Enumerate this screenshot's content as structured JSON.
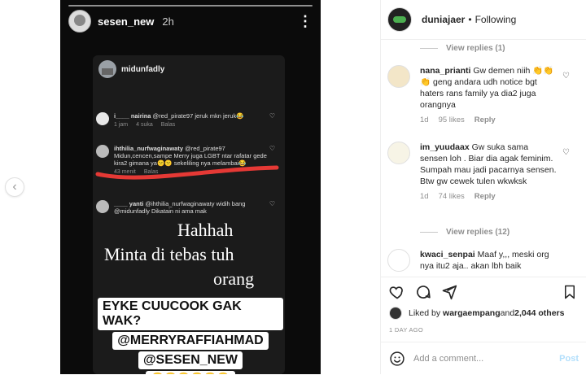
{
  "story": {
    "username": "sesen_new",
    "time": "2h",
    "more": "⋮",
    "card": {
      "username": "midunfadly",
      "comments": [
        {
          "user": "i____ nairina",
          "text": "@red_pirate97 jeruk mkn jeruk😂",
          "meta": [
            "1 jam",
            "4 suka",
            "Balas"
          ]
        },
        {
          "user": "ihthilia_nurfwaginawaty",
          "text": "@red_pirate97 Midun,cencen,sampe Merry juga LGBT ntar rafatar gede kira2 gimana ya😕😕 sekeliling nya melambai😂",
          "meta": [
            "43 menit",
            "Balas"
          ]
        },
        {
          "user": "____ yanti",
          "text": "@ihthilia_nurfwaginawaty widih bang @midunfadly Dikatain ni ama mak",
          "meta": []
        }
      ]
    },
    "overlay": [
      "Hahhah",
      "Minta di  tebas tuh",
      "orang"
    ],
    "sticker": [
      "EYKE CUUCOOK GAK WAK?",
      "@MERRYRAFFIAHMAD",
      "@SESEN_NEW",
      "😂😂😂😂😂😂"
    ]
  },
  "panel": {
    "header": {
      "username": "duniajaer",
      "dot": "•",
      "follow": "Following"
    },
    "view_replies_top": "View replies (1)",
    "comments": [
      {
        "user": "nana_prianti",
        "text": "Gw demen niih 👏👏👏 geng andara udh notice bgt haters rans family ya dia2 juga orangnya",
        "time": "1d",
        "likes": "95 likes",
        "reply": "Reply"
      },
      {
        "user": "im_yuudaax",
        "text": "Gw suka sama sensen loh . Biar dia agak feminim. Sumpah mau jadi pacarnya sensen. Btw gw cewek tulen wkwksk",
        "time": "1d",
        "likes": "74 likes",
        "reply": "Reply"
      },
      {
        "user": "kwaci_senpai",
        "text": "Maaf y,,, meski org nya itu2 aja.. akan lbh baik",
        "time": "",
        "likes": "",
        "reply": ""
      }
    ],
    "view_replies_mid": "View replies (12)",
    "liked_by": {
      "prefix": "Liked by ",
      "user": "wargaempang",
      "middle": " and ",
      "count": "2,044 others"
    },
    "date": "1 DAY AGO",
    "add_comment": {
      "placeholder": "Add a comment...",
      "post": "Post"
    }
  }
}
